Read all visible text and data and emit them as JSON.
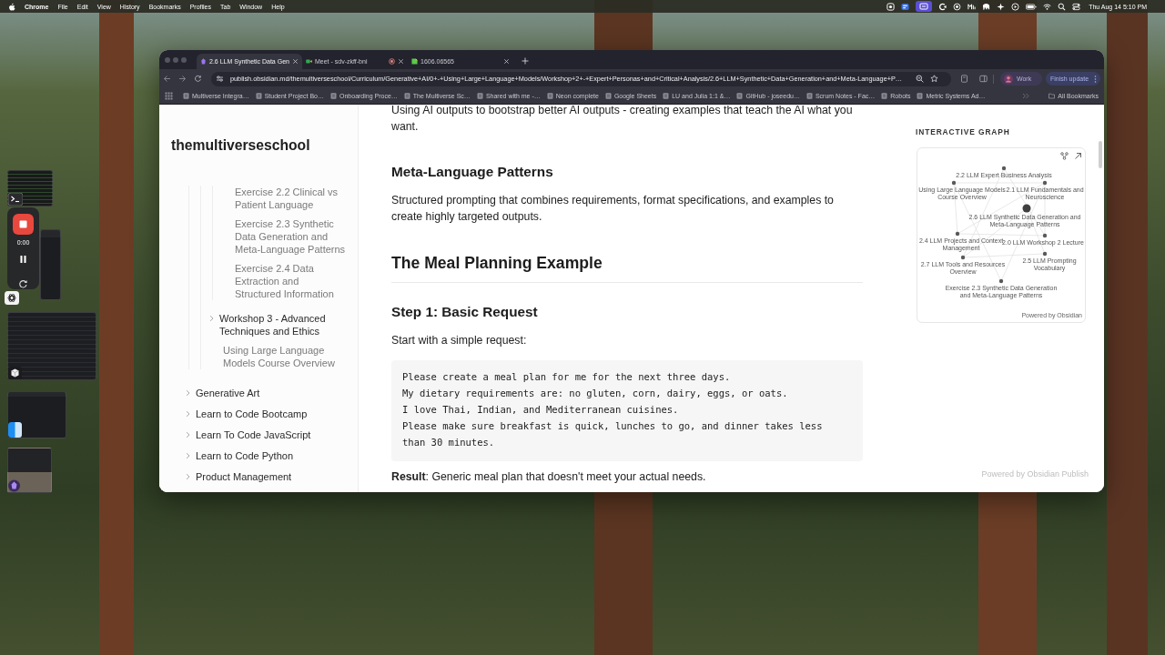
{
  "menu_bar": {
    "app": "Chrome",
    "menus": [
      "File",
      "Edit",
      "View",
      "History",
      "Bookmarks",
      "Profiles",
      "Tab",
      "Window",
      "Help"
    ],
    "clock": "Thu Aug 14 5:10 PM"
  },
  "recorder": {
    "elapsed": "0:00"
  },
  "browser": {
    "tabs": [
      {
        "kind": "notes",
        "title": "2.6 LLM Synthetic Data Gen",
        "selected": true,
        "recording": false
      },
      {
        "kind": "video",
        "title": "Meet - sdv-zkff-bni",
        "selected": false,
        "recording": true
      },
      {
        "kind": "document",
        "title": "1606.06565",
        "selected": false,
        "recording": false
      }
    ],
    "url": "publish.obsidian.md/themultiverseschool/Curriculum/Generative+AI/0+-+Using+Large+Language+Models/Workshop+2+-+Expert+Personas+and+Critical+Analysis/2.6+LLM+Synthetic+Data+Generation+and+Meta-Language+P…",
    "profile": "Work",
    "update": "Finish update",
    "bookmarks": [
      "Multiverse Integra…",
      "Student Project Bo…",
      "Onboarding Proce…",
      "The Multiverse Sc…",
      "Shared with me -…",
      "Neon complete",
      "Google Sheets",
      "LU and Julia 1:1 &…",
      "GitHub - joseedu…",
      "Scrum Notes - Fac…",
      "Robots",
      "Metric Systems Ad…"
    ],
    "all_bookmarks": "All Bookmarks"
  },
  "site": {
    "name": "themultiverseschool",
    "nav": [
      {
        "children": [
          {
            "children": [
              {
                "children": [
                  {
                    "kind": "note",
                    "label": "Exercise 2.2 Clinical vs Patient Language"
                  },
                  {
                    "kind": "note",
                    "label": "Exercise 2.3 Synthetic Data Generation and Meta-Language Patterns"
                  },
                  {
                    "kind": "note",
                    "label": "Exercise 2.4 Data Extraction and Structured Information"
                  }
                ]
              },
              {
                "kind": "folder",
                "label": "Workshop 3 - Advanced Techniques and Ethics",
                "expanded": false
              },
              {
                "kind": "note",
                "label": "Using Large Language Models Course Overview"
              }
            ]
          }
        ]
      },
      {
        "kind": "folder",
        "label": "Generative Art",
        "expanded": false
      },
      {
        "kind": "folder",
        "label": "Learn to Code Bootcamp",
        "expanded": false
      },
      {
        "kind": "folder",
        "label": "Learn To Code JavaScript",
        "expanded": false
      },
      {
        "kind": "folder",
        "label": "Learn to Code Python",
        "expanded": false
      },
      {
        "kind": "folder",
        "label": "Product Management",
        "expanded": false
      }
    ]
  },
  "article": [
    {
      "kind": "paragraph",
      "text": "Using AI outputs to bootstrap better AI outputs - creating examples that teach the AI what you want."
    },
    {
      "kind": "heading3",
      "text": "Meta-Language Patterns"
    },
    {
      "kind": "paragraph",
      "text": "Structured prompting that combines requirements, format specifications, and examples to create highly targeted outputs."
    },
    {
      "kind": "heading2",
      "text": "The Meal Planning Example"
    },
    {
      "kind": "heading3",
      "text": "Step 1: Basic Request"
    },
    {
      "kind": "paragraph",
      "text": "Start with a simple request:"
    },
    {
      "kind": "code",
      "lines": [
        "Please create a meal plan for me for the next three days.",
        "My dietary requirements are: no gluten, corn, dairy, eggs, or oats.",
        "I love Thai, Indian, and Mediterranean cuisines.",
        "Please make sure breakfast is quick, lunches to go, and dinner takes less than 30 minutes."
      ]
    },
    {
      "kind": "paragraph",
      "text": "**Result**: Generic meal plan that doesn't meet your actual needs."
    }
  ],
  "graph": {
    "title": "INTERACTIVE GRAPH",
    "nodes": [
      {
        "label": "2.2 LLM Expert Business Analysis",
        "current": false
      },
      {
        "label": "Using Large Language Models Course Overview",
        "current": false
      },
      {
        "label": "2.1 LLM Fundamentals and Neuroscience",
        "current": false
      },
      {
        "label": "2.6 LLM Synthetic Data Generation and Meta-Language Patterns",
        "current": true
      },
      {
        "label": "2.4 LLM Projects and Context Management",
        "current": false
      },
      {
        "label": "2.0 LLM Workshop 2 Lecture",
        "current": false
      },
      {
        "label": "2.7 LLM Tools and Resources Overview",
        "current": false
      },
      {
        "label": "Exercise 2.3 Synthetic Data Generation and Meta-Language Patterns",
        "current": false
      },
      {
        "label": "2.5 LLM Prompting Vocabulary",
        "current": false
      }
    ],
    "credit": "Powered by Obsidian"
  },
  "footer": "Powered by Obsidian Publish"
}
